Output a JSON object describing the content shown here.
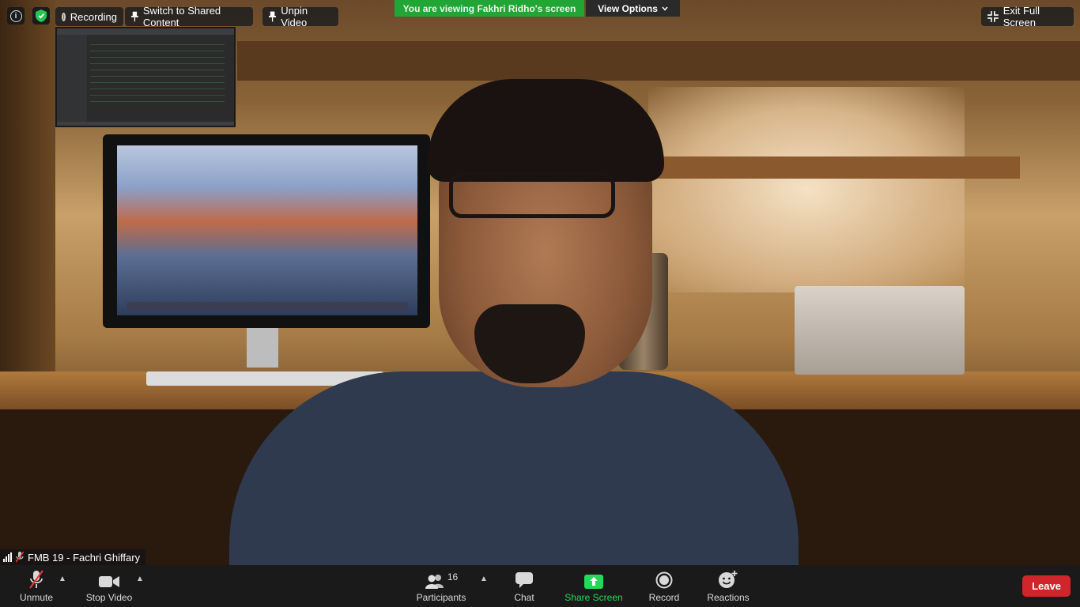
{
  "meeting": {
    "sharing_banner": "You are viewing Fakhri Ridho's screen",
    "view_options_label": "View Options",
    "recording_label": "Recording",
    "switch_label": "Switch to Shared Content",
    "unpin_label": "Unpin Video",
    "exit_fullscreen_label": "Exit Full Screen",
    "participant_name": "FMB 19 - Fachri Ghiffary"
  },
  "toolbar": {
    "unmute_label": "Unmute",
    "stop_video_label": "Stop Video",
    "participants_label": "Participants",
    "participants_count": "16",
    "chat_label": "Chat",
    "share_screen_label": "Share Screen",
    "record_label": "Record",
    "reactions_label": "Reactions",
    "leave_label": "Leave"
  },
  "icons": {
    "info": "info-icon",
    "security": "shield-icon",
    "record": "record-dot-icon",
    "pin": "pin-icon",
    "unpin": "pin-icon",
    "exit_fullscreen": "exit-fullscreen-icon",
    "signal": "signal-bars-icon",
    "mic_muted": "mic-muted-icon",
    "video": "video-camera-icon",
    "participants": "people-icon",
    "chat": "chat-bubble-icon",
    "share": "share-arrow-icon",
    "record_btn": "record-icon",
    "reactions": "smiley-plus-icon"
  },
  "colors": {
    "banner_green": "#21a535",
    "share_green": "#23d959",
    "leave_red": "#d0262b",
    "recording_red": "#e04a3c",
    "toolbar_bg": "#1a1a1a"
  }
}
